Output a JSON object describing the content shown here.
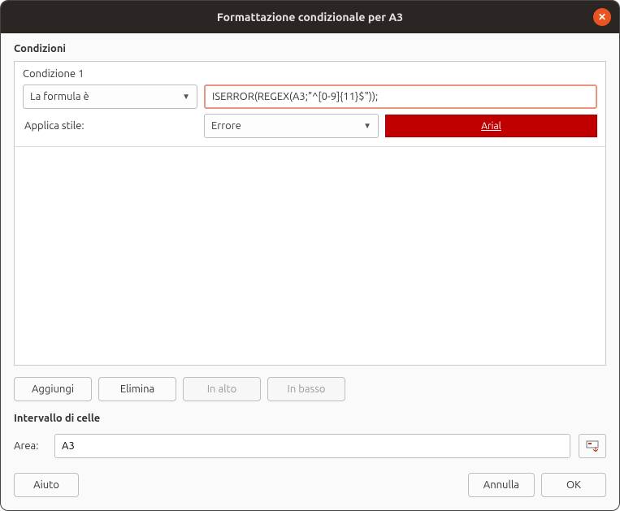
{
  "window": {
    "title": "Formattazione condizionale per A3"
  },
  "sections": {
    "conditions_label": "Condizioni",
    "range_label": "Intervallo di celle"
  },
  "condition": {
    "title": "Condizione 1",
    "type_selected": "La formula è",
    "formula": "ISERROR(REGEX(A3;\"^[0-9]{11}$\"));",
    "apply_style_label": "Applica stile:",
    "style_selected": "Errore",
    "preview_text": "Arial"
  },
  "buttons": {
    "add": "Aggiungi",
    "delete": "Elimina",
    "up": "In alto",
    "down": "In basso",
    "help": "Aiuto",
    "cancel": "Annulla",
    "ok": "OK"
  },
  "range": {
    "label": "Area:",
    "value": "A3"
  }
}
